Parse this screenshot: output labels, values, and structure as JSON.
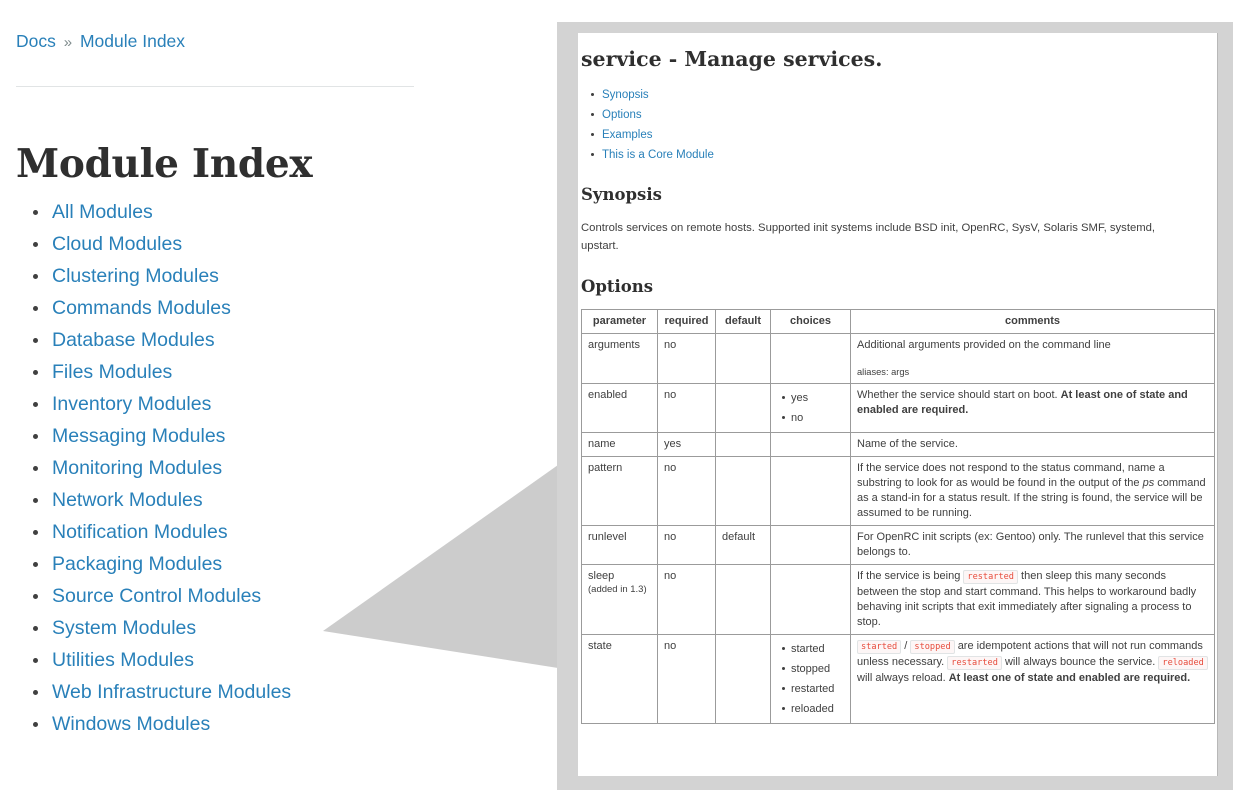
{
  "breadcrumb": {
    "root_label": "Docs",
    "separator": "»",
    "current_label": "Module Index"
  },
  "page_title": "Module Index",
  "module_index": {
    "items": [
      {
        "label": "All Modules"
      },
      {
        "label": "Cloud Modules"
      },
      {
        "label": "Clustering Modules"
      },
      {
        "label": "Commands Modules"
      },
      {
        "label": "Database Modules"
      },
      {
        "label": "Files Modules"
      },
      {
        "label": "Inventory Modules"
      },
      {
        "label": "Messaging Modules"
      },
      {
        "label": "Monitoring Modules"
      },
      {
        "label": "Network Modules"
      },
      {
        "label": "Notification Modules"
      },
      {
        "label": "Packaging Modules"
      },
      {
        "label": "Source Control Modules"
      },
      {
        "label": "System Modules"
      },
      {
        "label": "Utilities Modules"
      },
      {
        "label": "Web Infrastructure Modules"
      },
      {
        "label": "Windows Modules"
      }
    ]
  },
  "detail_panel": {
    "module_heading": "service - Manage services.",
    "toc": [
      {
        "label": "Synopsis"
      },
      {
        "label": "Options"
      },
      {
        "label": "Examples"
      },
      {
        "label": "This is a Core Module"
      }
    ],
    "synopsis": {
      "heading": "Synopsis",
      "text": "Controls services on remote hosts. Supported init systems include BSD init, OpenRC, SysV, Solaris SMF, systemd, upstart."
    },
    "options": {
      "heading": "Options",
      "columns": [
        "parameter",
        "required",
        "default",
        "choices",
        "comments"
      ],
      "rows": [
        {
          "parameter": "arguments",
          "parameter_note": "",
          "required": "no",
          "default": "",
          "choices": [],
          "comment_text": "Additional arguments provided on the command line",
          "aliases": "aliases: args"
        },
        {
          "parameter": "enabled",
          "parameter_note": "",
          "required": "no",
          "default": "",
          "choices": [
            "yes",
            "no"
          ],
          "comment_text": "Whether the service should start on boot.",
          "comment_strong": "At least one of state and enabled are required."
        },
        {
          "parameter": "name",
          "parameter_note": "",
          "required": "yes",
          "default": "",
          "choices": [],
          "comment_text": "Name of the service."
        },
        {
          "parameter": "pattern",
          "parameter_note": "",
          "required": "no",
          "default": "",
          "choices": [],
          "comment_part1": "If the service does not respond to the status command, name a substring to look for as would be found in the output of the",
          "comment_em": "ps",
          "comment_part2": "command as a stand-in for a status result. If the string is found, the service will be assumed to be running."
        },
        {
          "parameter": "runlevel",
          "parameter_note": "",
          "required": "no",
          "default": "default",
          "choices": [],
          "comment_text": "For OpenRC init scripts (ex: Gentoo) only. The runlevel that this service belongs to."
        },
        {
          "parameter": "sleep",
          "parameter_note": "(added in 1.3)",
          "required": "no",
          "default": "",
          "choices": [],
          "comment_part1": "If the service is being",
          "comment_code1": "restarted",
          "comment_part2": "then sleep this many seconds between the stop and start command. This helps to workaround badly behaving init scripts that exit immediately after signaling a process to stop."
        },
        {
          "parameter": "state",
          "parameter_note": "",
          "required": "no",
          "default": "",
          "choices": [
            "started",
            "stopped",
            "restarted",
            "reloaded"
          ],
          "comment_code1": "started",
          "comment_slash": "/",
          "comment_code2": "stopped",
          "comment_part1": "are idempotent actions that will not run commands unless necessary.",
          "comment_code3": "restarted",
          "comment_part2": "will always bounce the service.",
          "comment_code4": "reloaded",
          "comment_part3": "will always reload.",
          "comment_strong": "At least one of state and enabled are required."
        }
      ]
    }
  },
  "colors": {
    "link": "#2980b9",
    "text": "#404040",
    "heading": "#2f2f2f",
    "panel_border": "#d3d3d3",
    "callout": "#cccccc",
    "code": "#e74c3c",
    "rule": "#e1e4e5"
  }
}
